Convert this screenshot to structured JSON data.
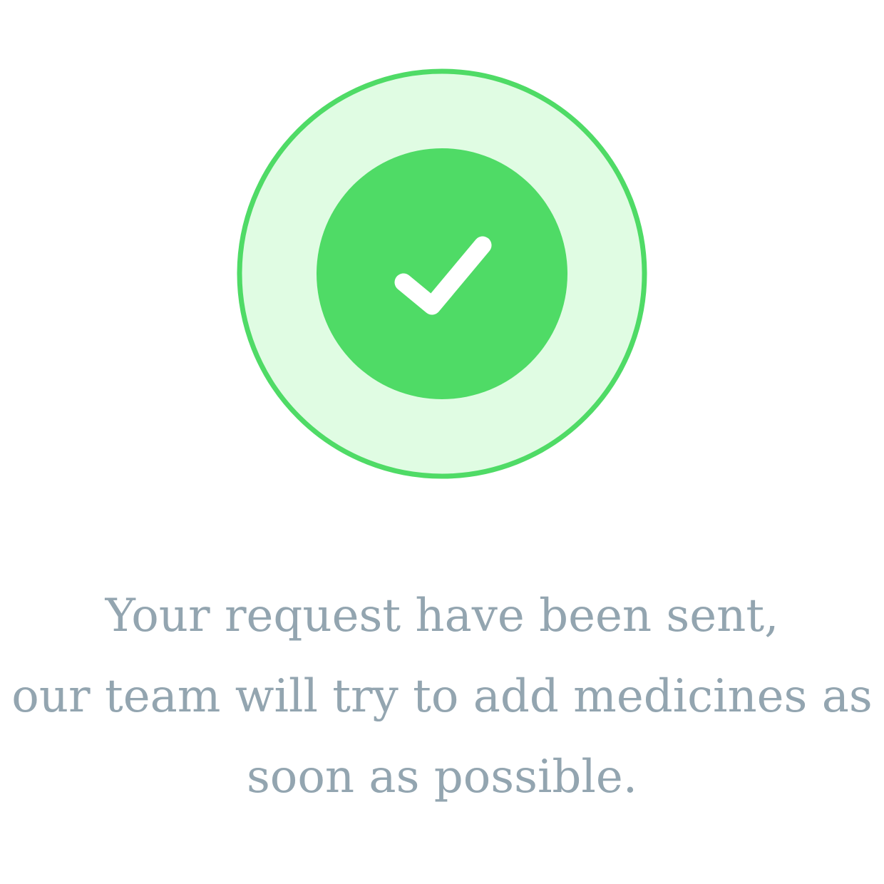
{
  "icon": {
    "name": "checkmark-icon",
    "outer_ring_fill": "#e0fce3",
    "outer_ring_stroke": "#4fdb66",
    "inner_circle_fill": "#4fdb66",
    "check_color": "#ffffff"
  },
  "message": {
    "line1": "Your request have been sent,",
    "line2": "our team will try to add medicines as",
    "line3": "soon as possible.",
    "text_color": "#93a5b0"
  }
}
